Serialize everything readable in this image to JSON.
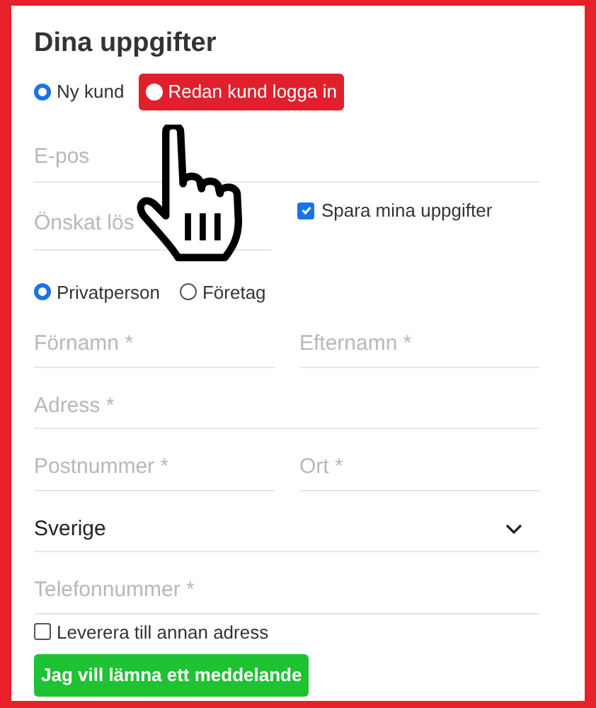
{
  "title": "Dina uppgifter",
  "customer_type": [
    {
      "label": "Ny kund",
      "selected": true,
      "kind": "plain"
    },
    {
      "label": "Redan kund logga in",
      "selected": false,
      "kind": "highlighted"
    }
  ],
  "email": {
    "placeholder": "E-pos"
  },
  "password": {
    "placeholder": "Önskat lös"
  },
  "save_details": {
    "label": "Spara mina uppgifter",
    "checked": true
  },
  "person_type": [
    {
      "label": "Privatperson",
      "selected": true
    },
    {
      "label": "Företag",
      "selected": false
    }
  ],
  "address_rows": [
    {
      "fields": [
        {
          "kind": "input",
          "placeholder": "Förnamn *"
        },
        {
          "kind": "input",
          "placeholder": "Efternamn *"
        }
      ]
    },
    {
      "fields": [
        {
          "kind": "input",
          "placeholder": "Adress *"
        }
      ]
    },
    {
      "fields": [
        {
          "kind": "input",
          "placeholder": "Postnummer *"
        },
        {
          "kind": "input",
          "placeholder": "Ort *"
        }
      ]
    },
    {
      "fields": [
        {
          "kind": "select",
          "value": "Sverige"
        }
      ]
    },
    {
      "fields": [
        {
          "kind": "input",
          "placeholder": "Telefonnummer *"
        }
      ]
    }
  ],
  "deliver_elsewhere": {
    "label": "Leverera till annan adress",
    "checked": false
  },
  "message_button": "Jag vill lämna ett meddelande"
}
